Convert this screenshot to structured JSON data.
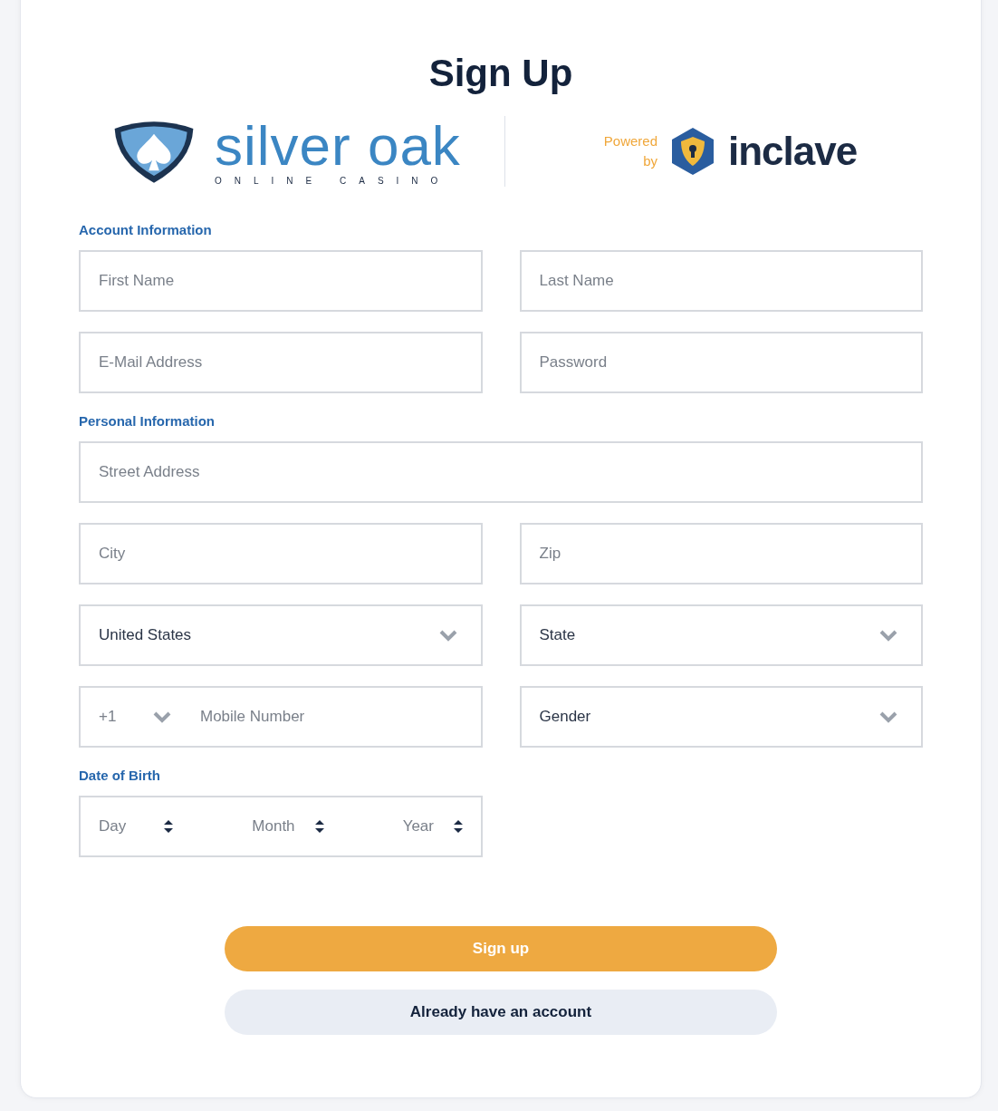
{
  "title": "Sign Up",
  "brand": {
    "name": "silver oak",
    "tagline": "ONLINE CASINO"
  },
  "partner": {
    "label": "Powered by",
    "name": "inclave"
  },
  "sections": [
    {
      "heading": "Account Information",
      "rows": [
        [
          {
            "kind": "text",
            "placeholder": "First Name"
          },
          {
            "kind": "text",
            "placeholder": "Last Name"
          }
        ],
        [
          {
            "kind": "text",
            "placeholder": "E-Mail Address"
          },
          {
            "kind": "text",
            "placeholder": "Password"
          }
        ]
      ]
    },
    {
      "heading": "Personal Information",
      "rows": [
        [
          {
            "kind": "text",
            "placeholder": "Street Address"
          }
        ],
        [
          {
            "kind": "text",
            "placeholder": "City"
          },
          {
            "kind": "text",
            "placeholder": "Zip"
          }
        ],
        [
          {
            "kind": "select",
            "value": "United States"
          },
          {
            "kind": "select",
            "value": "State"
          }
        ],
        [
          {
            "kind": "phone",
            "code": "+1",
            "placeholder": "Mobile Number"
          },
          {
            "kind": "select",
            "value": "Gender"
          }
        ]
      ]
    },
    {
      "heading": "Date of Birth",
      "rows": [
        [
          {
            "kind": "date",
            "parts": [
              "Day",
              "Month",
              "Year"
            ]
          }
        ]
      ]
    }
  ],
  "buttons": [
    {
      "kind": "primary",
      "label": "Sign up"
    },
    {
      "kind": "secondary",
      "label": "Already have an account"
    }
  ]
}
